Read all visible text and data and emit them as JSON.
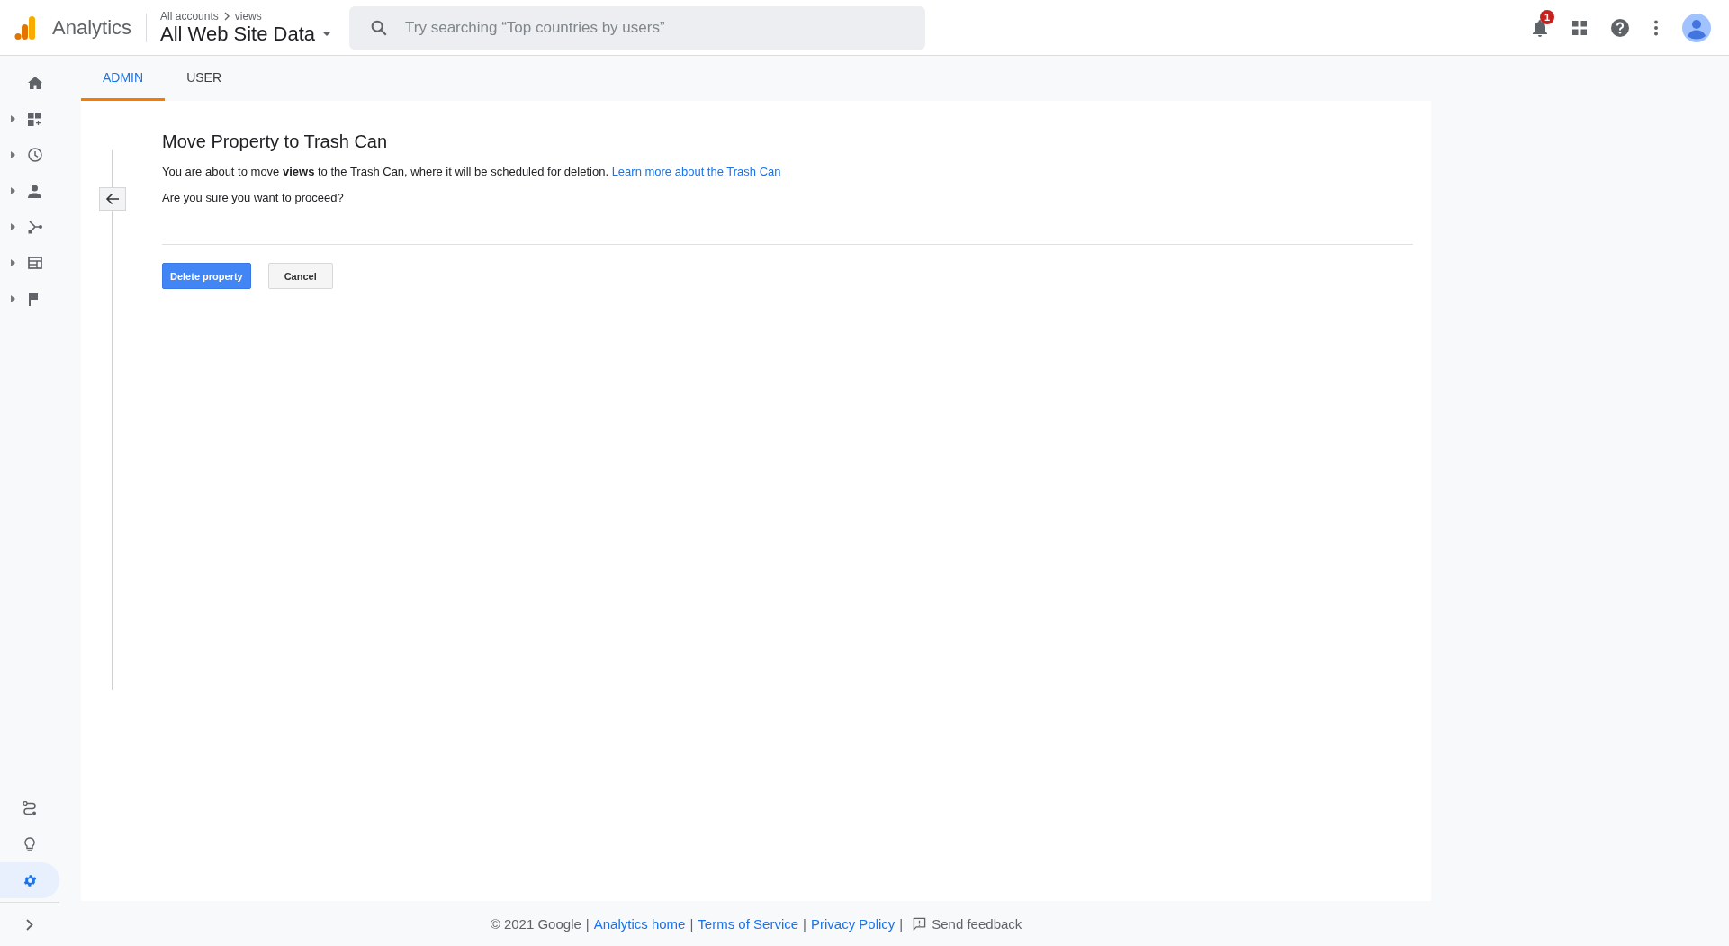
{
  "header": {
    "product": "Analytics",
    "breadcrumb": [
      "All accounts",
      "views"
    ],
    "view": "All Web Site Data",
    "search": {
      "placeholder": "Try searching “Top countries by users”"
    },
    "notifications": "1"
  },
  "sidebar": {
    "items": [
      {
        "expandable": false,
        "selected": false
      },
      {
        "expandable": true,
        "selected": false
      },
      {
        "expandable": true,
        "selected": false
      },
      {
        "expandable": true,
        "selected": false
      },
      {
        "expandable": true,
        "selected": false
      },
      {
        "expandable": true,
        "selected": false
      },
      {
        "expandable": true,
        "selected": false
      }
    ],
    "bottom_items": [
      {
        "selected": false
      },
      {
        "selected": false
      },
      {
        "selected": true
      }
    ]
  },
  "tabs": [
    {
      "label": "ADMIN",
      "selected": true
    },
    {
      "label": "USER",
      "selected": false
    }
  ],
  "dialog": {
    "title": "Move Property to Trash Can",
    "message": "You are about to move **views** to the Trash Can, where it will be scheduled for deletion.",
    "link": "Learn more about the Trash Can",
    "question": "Are you sure you want to proceed?",
    "buttons": [
      {
        "label": "Delete property",
        "kind": "primary"
      },
      {
        "label": "Cancel",
        "kind": "secondary"
      }
    ]
  },
  "footer": {
    "copyright": "© 2021 Google",
    "separators": [
      "|",
      "|",
      "|",
      "|"
    ],
    "links": [
      "Analytics home",
      "Terms of Service",
      "Privacy Policy"
    ],
    "feedback": "Send feedback"
  }
}
